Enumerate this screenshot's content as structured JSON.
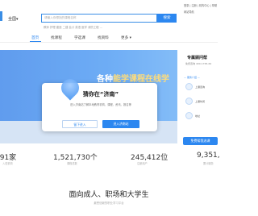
{
  "header": {
    "city": "全国",
    "search_placeholder": "请输入你想找的课程名称",
    "search_button": "搜索",
    "hot_keywords": "教师  护理  建造  二建  会计  英语  医学  消防工程  …",
    "top_links": "登录 | 注册 | 机构中心 | 帮助",
    "top_link2": "网站导航"
  },
  "nav": {
    "items": [
      "首页",
      "找课程",
      "学选课",
      "找资料",
      "更多"
    ],
    "active_index": 0
  },
  "banner": {
    "headline_part1": "各种",
    "headline_part2": "能学课程在线学"
  },
  "side_panel": {
    "title": "专属顾问帮",
    "subtitle": "免费咨询 400-1765-60",
    "line": "— 服务介绍 —",
    "rows": [
      "上课咨询",
      "上课时间",
      "地址"
    ],
    "button": "免费帮我选课"
  },
  "modal": {
    "title": "猜你在“济南”",
    "description": "进入济南站了解本地教育机构、课程、资讯、报名等",
    "cancel": "留下进入",
    "confirm": "进入济南站"
  },
  "stats": [
    {
      "value": "191家",
      "label": "入驻机构"
    },
    {
      "value": "1,521,730个",
      "label": "课程总数"
    },
    {
      "value": "245,412位",
      "label": "注册用户"
    },
    {
      "value": "9,351,",
      "label": "累计服务"
    }
  ],
  "footer": {
    "title": "面向成人、职场和大学生",
    "subtitle": "最受信赖的职业学习平台"
  },
  "colors": {
    "accent": "#2c87f0",
    "banner": "#3d91f2"
  }
}
